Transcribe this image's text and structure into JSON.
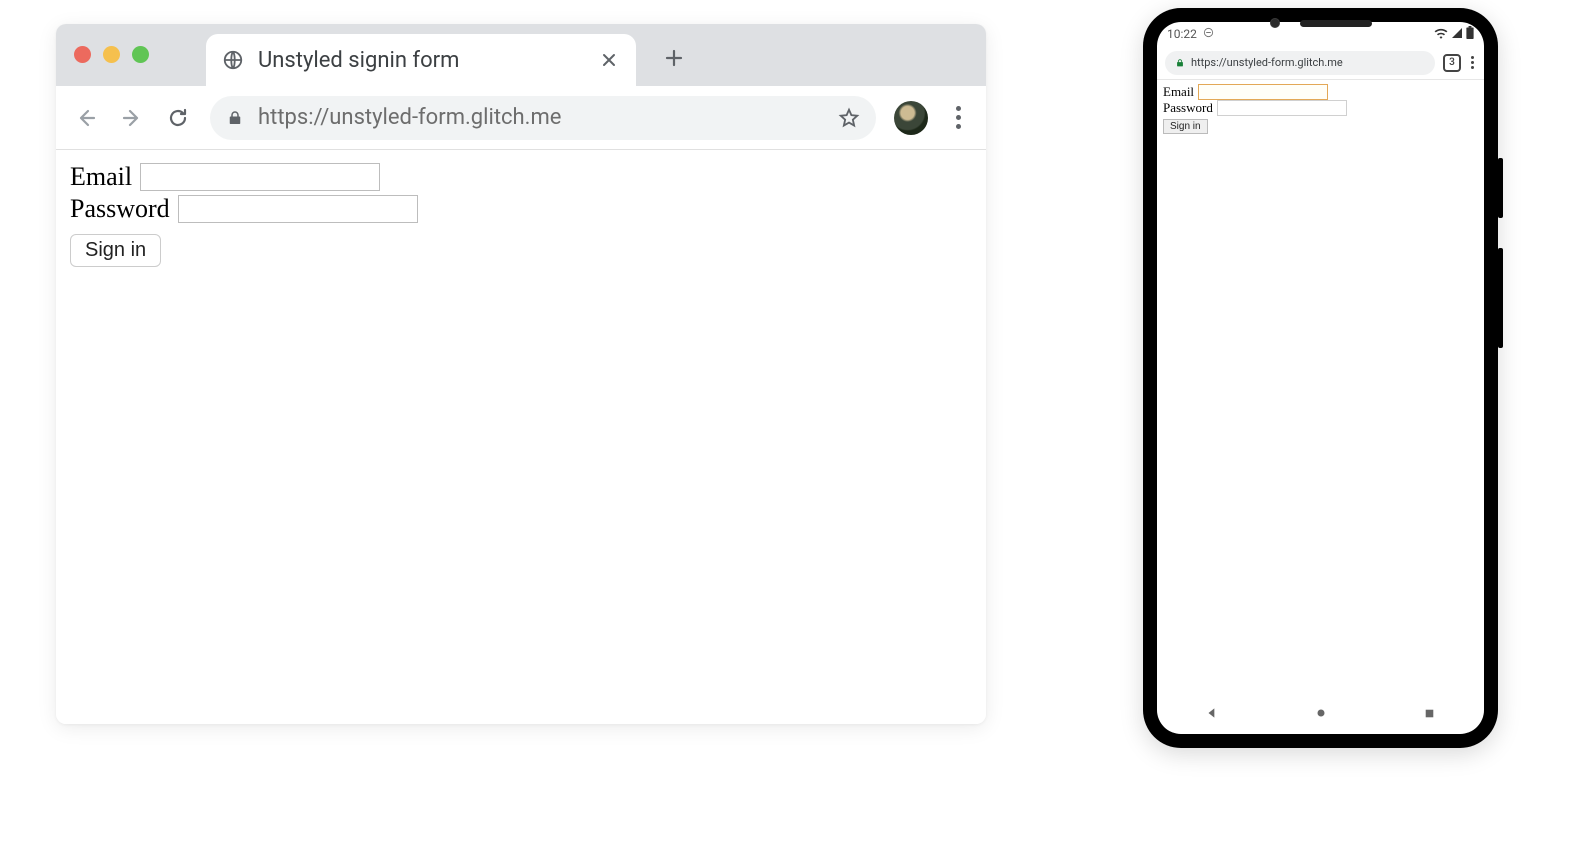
{
  "browser": {
    "tab_title": "Unstyled signin form",
    "url": "https://unstyled-form.glitch.me"
  },
  "desktop": {
    "email_label": "Email",
    "password_label": "Password",
    "signin_label": "Sign in"
  },
  "phone": {
    "status_time": "10:22",
    "tab_count": "3",
    "url": "https://unstyled-form.glitch.me",
    "email_label": "Email",
    "password_label": "Password",
    "signin_label": "Sign in"
  }
}
